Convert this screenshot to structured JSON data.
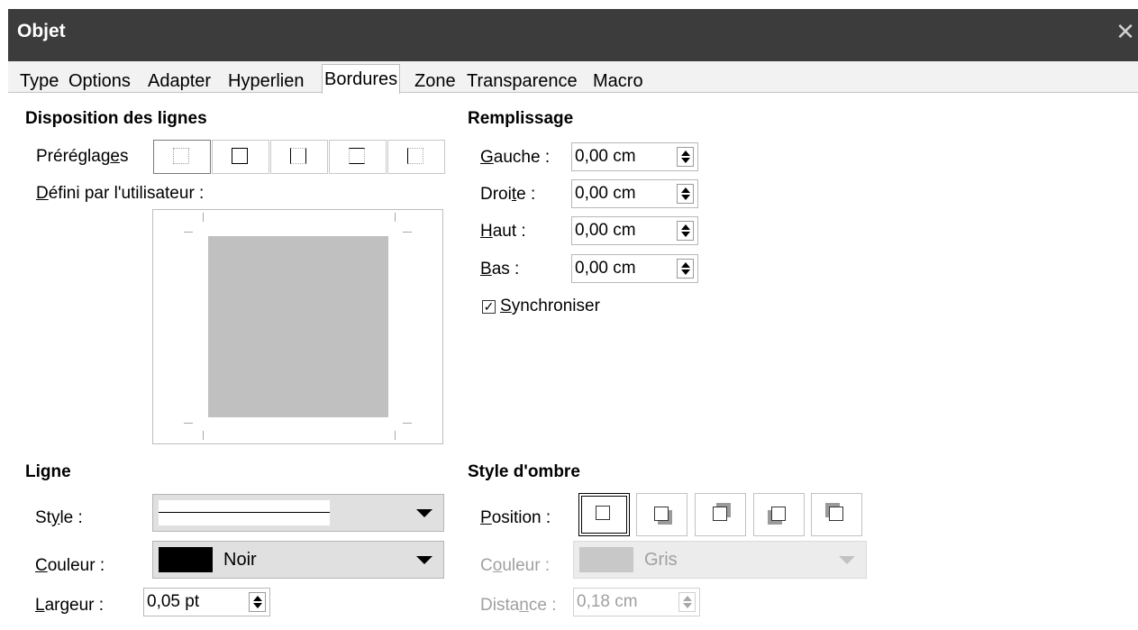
{
  "window": {
    "title": "Objet",
    "close_glyph": "✕"
  },
  "tabs": [
    {
      "label": "Type"
    },
    {
      "label": "Options"
    },
    {
      "label": "Adapter"
    },
    {
      "label": "Hyperlien"
    },
    {
      "label": "Bordures",
      "active": true
    },
    {
      "label": "Zone"
    },
    {
      "label": "Transparence"
    },
    {
      "label": "Macro"
    }
  ],
  "line_arrangement": {
    "heading": "Disposition des lignes",
    "presets_label_pre": "Préréglag",
    "presets_label_ul": "e",
    "presets_label_post": "s",
    "user_defined_ul": "D",
    "user_defined_rest": "éfini par l'utilisateur :"
  },
  "padding": {
    "heading": "Remplissage",
    "left": {
      "ul": "G",
      "rest": "auche :",
      "value": "0,00 cm"
    },
    "right": {
      "pre": "Droi",
      "ul": "t",
      "rest": "e :",
      "value": "0,00 cm"
    },
    "top": {
      "ul": "H",
      "rest": "aut :",
      "value": "0,00 cm"
    },
    "bottom": {
      "ul": "B",
      "rest": "as :",
      "value": "0,00 cm"
    },
    "sync": {
      "ul": "S",
      "rest": "ynchroniser",
      "checked": true
    }
  },
  "line": {
    "heading": "Ligne",
    "style": {
      "pre": "St",
      "ul": "y",
      "rest": "le :"
    },
    "color": {
      "ul": "C",
      "rest": "ouleur :",
      "value": "Noir",
      "swatch": "#000000"
    },
    "width": {
      "ul": "L",
      "rest": "argeur :",
      "value": "0,05 pt"
    }
  },
  "shadow": {
    "heading": "Style d'ombre",
    "position": {
      "ul": "P",
      "rest": "osition :"
    },
    "color": {
      "pre": "C",
      "ul": "o",
      "rest": "uleur :",
      "value": "Gris",
      "swatch": "#c8c8c8"
    },
    "distance": {
      "pre": "Dista",
      "ul": "n",
      "rest": "ce :",
      "value": "0,18 cm"
    }
  }
}
